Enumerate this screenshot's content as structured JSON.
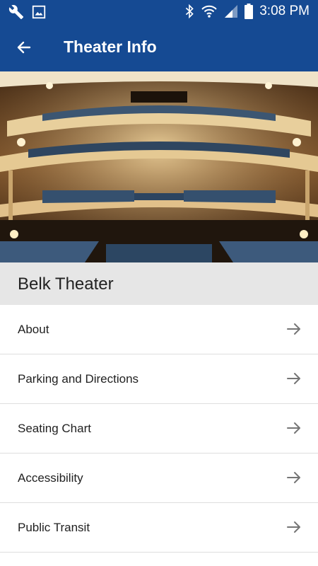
{
  "status_bar": {
    "time": "3:08 PM",
    "icons": [
      "wrench-icon",
      "image-icon",
      "bluetooth-icon",
      "wifi-icon",
      "signal-icon",
      "battery-icon"
    ]
  },
  "app_bar": {
    "title": "Theater Info",
    "back_icon": "arrow-left-icon",
    "color": "#154a93"
  },
  "hero": {
    "image": "theater-auditorium-photo"
  },
  "section": {
    "title": "Belk Theater"
  },
  "menu": {
    "items": [
      {
        "label": "About"
      },
      {
        "label": "Parking and Directions"
      },
      {
        "label": "Seating Chart"
      },
      {
        "label": "Accessibility"
      },
      {
        "label": "Public Transit"
      }
    ],
    "arrow_icon": "arrow-right-icon"
  }
}
